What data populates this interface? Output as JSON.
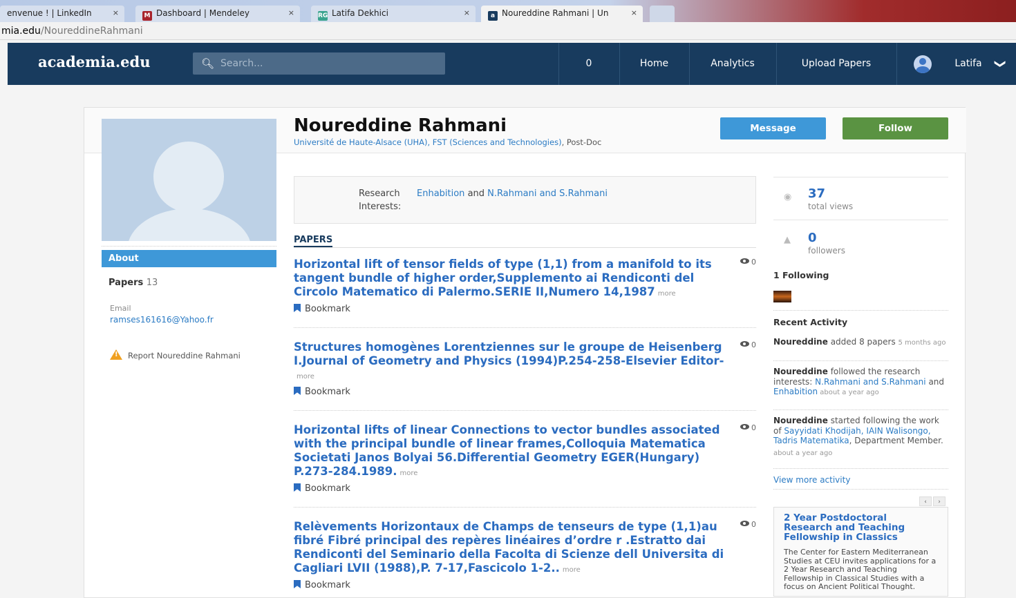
{
  "browser": {
    "tabs": [
      {
        "label": "envenue ! | LinkedIn",
        "favicon": "",
        "active": false
      },
      {
        "label": "Dashboard | Mendeley",
        "favicon": "mendeley-icon",
        "active": false
      },
      {
        "label": "Latifa Dekhici",
        "favicon": "researchgate-icon",
        "active": false
      },
      {
        "label": "Noureddine Rahmani | Un",
        "favicon": "academia-icon",
        "active": true
      }
    ],
    "close_glyph": "×",
    "address_domain": "mia.edu",
    "address_path": "/NoureddineRahmani"
  },
  "nav": {
    "logo": "academia.edu",
    "search_placeholder": "Search...",
    "notifications_count": "0",
    "home": "Home",
    "analytics": "Analytics",
    "upload": "Upload Papers",
    "user_name": "Latifa",
    "chevron": "❯"
  },
  "profile": {
    "name": "Noureddine Rahmani",
    "affiliation_org": "Université de Haute-Alsace (UHA), FST (Sciences and Technologies)",
    "affiliation_role": ", Post-Doc",
    "message_label": "Message",
    "follow_label": "Follow"
  },
  "sidebar": {
    "about": "About",
    "papers_label": "Papers",
    "papers_count": "13",
    "email_label": "Email",
    "email": "ramses161616@Yahoo.fr",
    "report": "Report Noureddine Rahmani"
  },
  "interests": {
    "label": "Research Interests:",
    "first": "Enhabition",
    "and": " and ",
    "second": "N.Rahmani and S.Rahmani"
  },
  "papers_heading": "PAPERS",
  "papers": [
    {
      "title": "Horizontal lift of tensor fields of type (1,1) from a manifold to its tangent bundle of higher order,Supplemento ai Rendiconti del Circolo Matematico di Palermo.SERIE II,Numero 14,1987",
      "more": "more",
      "views": "0",
      "bookmark": "Bookmark"
    },
    {
      "title": "Structures homogènes Lorentziennes sur le groupe de Heisenberg I.Journal of Geometry and Physics (1994)P.254-258-Elsevier Editor-",
      "more": "more",
      "views": "0",
      "bookmark": "Bookmark"
    },
    {
      "title": "Horizontal lifts of linear Connections to vector bundles associated with the principal bundle of linear frames,Colloquia Matematica Societati Janos Bolyai 56.Differential Geometry EGER(Hungary) P.273-284.1989.",
      "more": "more",
      "views": "0",
      "bookmark": "Bookmark"
    },
    {
      "title": "Relèvements Horizontaux de Champs de tenseurs de type (1,1)au fibré Fibré principal des repères linéaires d’ordre r .Estratto dai Rendiconti del Seminario della Facolta di Scienze dell Universita di Cagliari LVII (1988),P. 7-17,Fascicolo 1-2..",
      "more": "more",
      "views": "0",
      "bookmark": "Bookmark"
    }
  ],
  "stats": {
    "views_count": "37",
    "views_label": "total views",
    "followers_count": "0",
    "followers_label": "followers"
  },
  "following_title": "1 Following",
  "activity": {
    "title": "Recent Activity",
    "a1_name": "Noureddine",
    "a1_text": " added 8 papers ",
    "a1_ago": "5 months ago",
    "a2_name": "Noureddine",
    "a2_text": " followed the research interests: ",
    "a2_link1": "N.Rahmani and S.Rahmani",
    "a2_and": " and ",
    "a2_link2": "Enhabition",
    "a2_ago": " about a year ago",
    "a3_name": "Noureddine",
    "a3_text": " started following the work of ",
    "a3_link": "Sayyidati Khodijah, IAIN Walisongo, Tadris Matematika",
    "a3_rest": ", Department Member.",
    "a3_ago": " about a year ago",
    "view_more": "View more activity"
  },
  "ad": {
    "prev": "‹",
    "next": "›",
    "title": "2 Year Postdoctoral Research and Teaching Fellowship in Classics",
    "text": "The Center for Eastern Mediterranean Studies at CEU invites applications for a 2 Year Research and Teaching Fellowship in Classical Studies with a focus on Ancient Political Thought."
  },
  "colors": {
    "nav": "#183b5e",
    "link": "#2b6cc0",
    "message": "#3e98d8",
    "follow": "#5a9342"
  }
}
